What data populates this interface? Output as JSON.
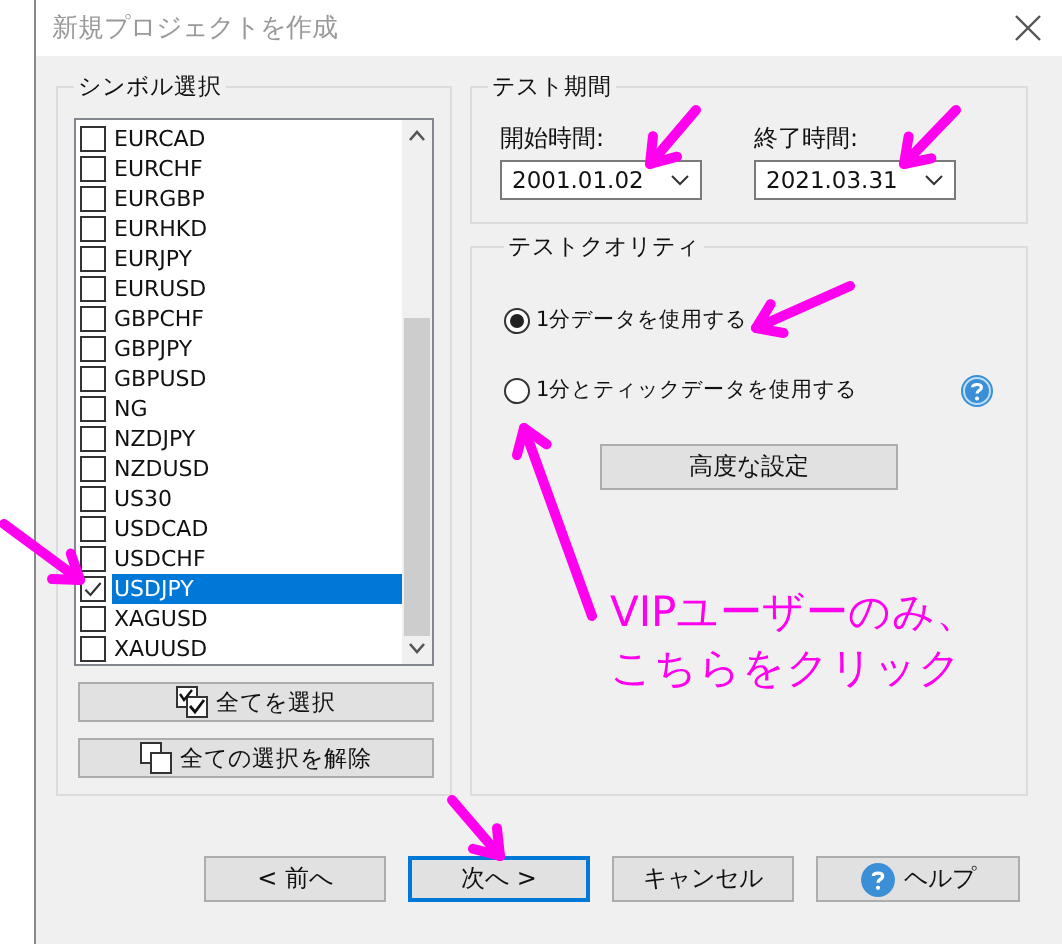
{
  "window": {
    "title": "新規プロジェクトを作成"
  },
  "symbol_group": {
    "title": "シンボル選択",
    "symbols": [
      {
        "name": "EURCAD",
        "checked": false,
        "selected": false
      },
      {
        "name": "EURCHF",
        "checked": false,
        "selected": false
      },
      {
        "name": "EURGBP",
        "checked": false,
        "selected": false
      },
      {
        "name": "EURHKD",
        "checked": false,
        "selected": false
      },
      {
        "name": "EURJPY",
        "checked": false,
        "selected": false
      },
      {
        "name": "EURUSD",
        "checked": false,
        "selected": false
      },
      {
        "name": "GBPCHF",
        "checked": false,
        "selected": false
      },
      {
        "name": "GBPJPY",
        "checked": false,
        "selected": false
      },
      {
        "name": "GBPUSD",
        "checked": false,
        "selected": false
      },
      {
        "name": "NG",
        "checked": false,
        "selected": false
      },
      {
        "name": "NZDJPY",
        "checked": false,
        "selected": false
      },
      {
        "name": "NZDUSD",
        "checked": false,
        "selected": false
      },
      {
        "name": "US30",
        "checked": false,
        "selected": false
      },
      {
        "name": "USDCAD",
        "checked": false,
        "selected": false
      },
      {
        "name": "USDCHF",
        "checked": false,
        "selected": false
      },
      {
        "name": "USDJPY",
        "checked": true,
        "selected": true
      },
      {
        "name": "XAGUSD",
        "checked": false,
        "selected": false
      },
      {
        "name": "XAUUSD",
        "checked": false,
        "selected": false
      }
    ],
    "select_all": "全てを選択",
    "deselect_all": "全ての選択を解除"
  },
  "period_group": {
    "title": "テスト期間",
    "start": {
      "label": "開始時間:",
      "value": "2001.01.02"
    },
    "end": {
      "label": "終了時間:",
      "value": "2021.03.31"
    }
  },
  "quality_group": {
    "title": "テストクオリティ",
    "options": [
      {
        "label": "1分データを使用する",
        "selected": true
      },
      {
        "label": "1分とティックデータを使用する",
        "selected": false
      }
    ],
    "advanced": "高度な設定"
  },
  "buttons": [
    {
      "label": "< 前へ",
      "kind": "plain",
      "focused": false
    },
    {
      "label": "次へ >",
      "kind": "plain",
      "focused": true
    },
    {
      "label": "キャンセル",
      "kind": "plain",
      "focused": false
    },
    {
      "label": "ヘルプ",
      "kind": "help",
      "focused": false
    }
  ],
  "annotation": {
    "lines": [
      "VIPユーザーのみ、",
      "こちらをクリック"
    ]
  }
}
